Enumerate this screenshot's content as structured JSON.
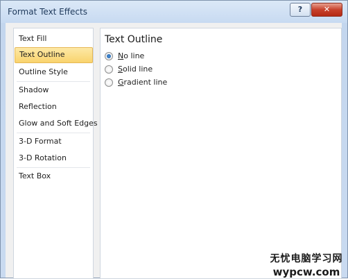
{
  "window": {
    "title": "Format Text Effects",
    "help_glyph": "?",
    "close_glyph": "✕"
  },
  "sidebar": {
    "items": [
      {
        "label": "Text Fill",
        "selected": false
      },
      {
        "label": "Text Outline",
        "selected": true
      },
      {
        "label": "Outline Style",
        "selected": false
      },
      {
        "label": "Shadow",
        "selected": false
      },
      {
        "label": "Reflection",
        "selected": false
      },
      {
        "label": "Glow and Soft Edges",
        "selected": false
      },
      {
        "label": "3-D Format",
        "selected": false
      },
      {
        "label": "3-D Rotation",
        "selected": false
      },
      {
        "label": "Text Box",
        "selected": false
      }
    ]
  },
  "main": {
    "heading": "Text Outline",
    "options": [
      {
        "accesskey": "N",
        "rest": "o line",
        "checked": true
      },
      {
        "accesskey": "S",
        "rest": "olid line",
        "checked": false
      },
      {
        "accesskey": "G",
        "rest": "radient line",
        "checked": false
      }
    ]
  },
  "watermark": {
    "line1": "无忧电脑学习网",
    "line2": "wypcw.com"
  },
  "colors": {
    "selection_fill": "#f9d36d",
    "radio_checked": "#1d5fa8",
    "close_button": "#c7412b"
  }
}
